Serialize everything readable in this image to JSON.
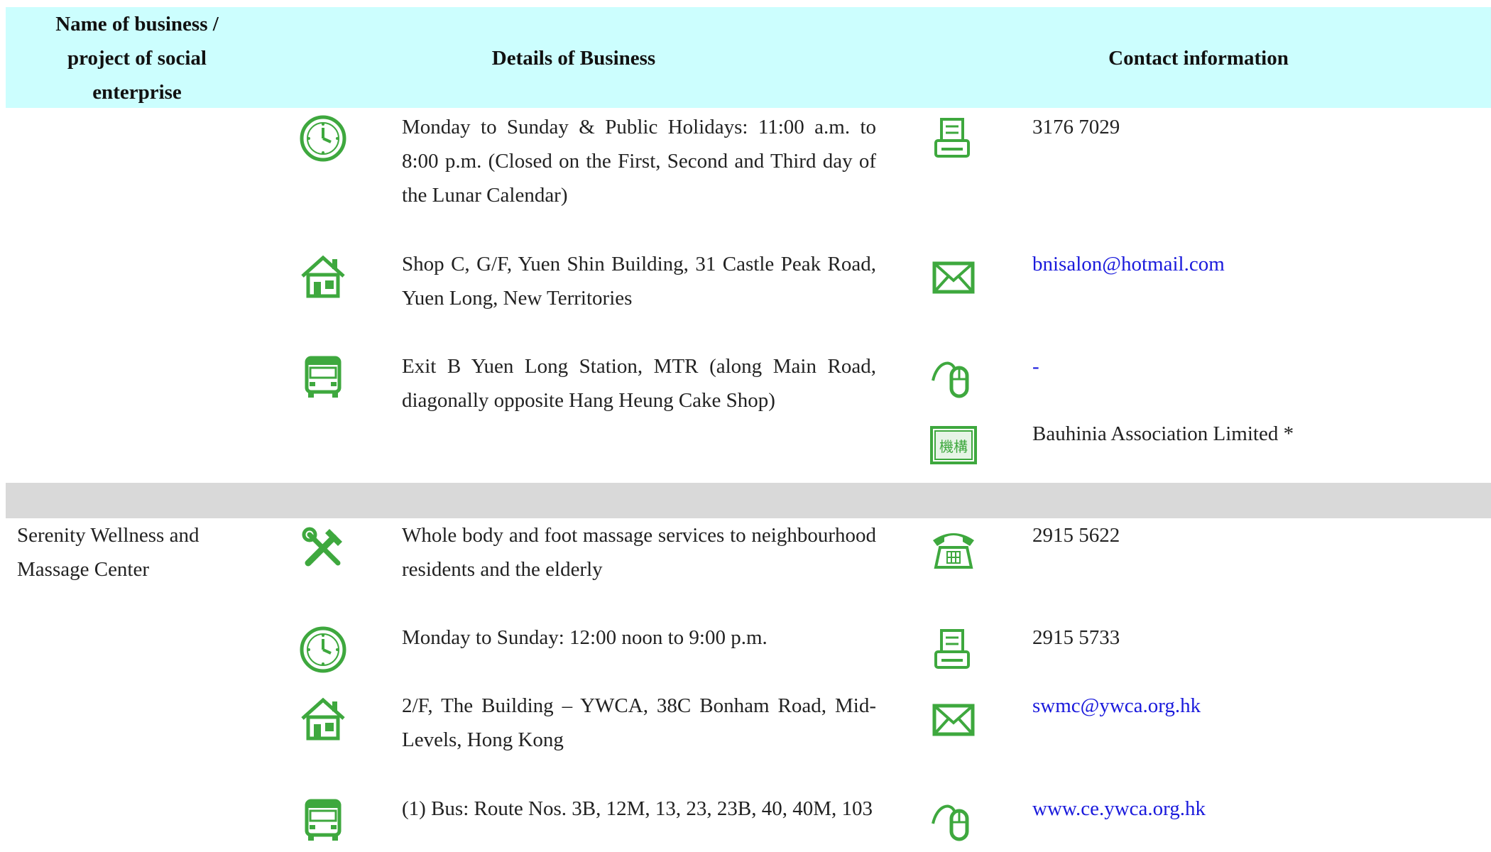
{
  "header": {
    "col1": "Name of business / project of social enterprise",
    "col2": "Details of Business",
    "col3": "Contact information"
  },
  "entry1": {
    "hours": "Monday to Sunday & Public Holidays: 11:00 a.m. to 8:00 p.m. (Closed on the First, Second and Third day of the Lunar Calendar)",
    "address": "Shop C, G/F, Yuen Shin Building, 31 Castle Peak Road, Yuen Long, New Territories",
    "transport": "Exit B Yuen Long Station, MTR (along Main Road, diagonally opposite Hang Heung Cake Shop)",
    "fax": "3176 7029",
    "email": "bnisalon@hotmail.com",
    "website": "-",
    "organisation": "Bauhinia Association Limited *"
  },
  "entry2": {
    "name": "Serenity Wellness and Massage Center",
    "services": "Whole body and foot massage services to neighbourhood residents and the elderly",
    "hours": "Monday to Sunday: 12:00 noon to 9:00 p.m.",
    "address": "2/F, The Building – YWCA, 38C Bonham Road, Mid-Levels, Hong Kong",
    "transport": "(1) Bus: Route Nos. 3B, 12M, 13, 23, 23B, 40, 40M, 103",
    "phone": "2915 5622",
    "fax": "2915 5733",
    "email": "swmc@ywca.org.hk",
    "website": "www.ce.ywca.org.hk"
  },
  "icons": {
    "color": "#3ea83e",
    "org_badge_text": "機構"
  }
}
